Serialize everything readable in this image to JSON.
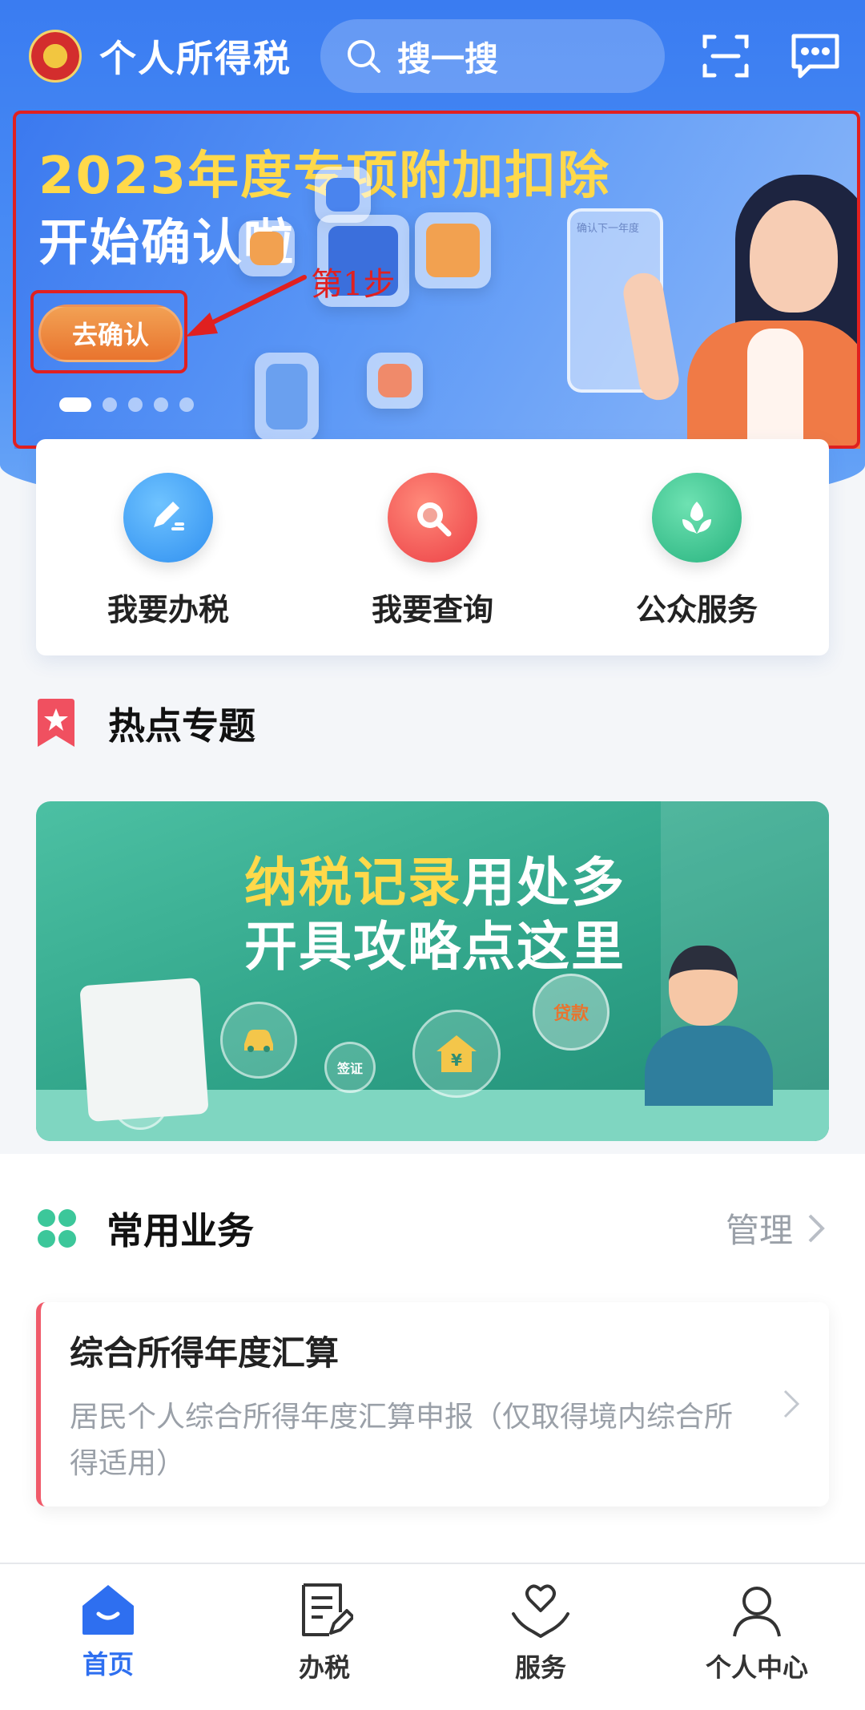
{
  "header": {
    "app_title": "个人所得税",
    "search_label": "搜一搜"
  },
  "banner": {
    "title_highlight_year": "2023年度",
    "title_highlight_rest": "专项附加扣除",
    "title_line2": "开始确认啦",
    "button_label": "去确认",
    "phone_text": "确认下一年度",
    "carousel": {
      "count": 5,
      "active_index": 0
    }
  },
  "annotation": {
    "step_label": "第1步",
    "color": "#e02020"
  },
  "quick_actions": [
    {
      "label": "我要办税",
      "icon": "edit-icon",
      "color": "#3aa3f5"
    },
    {
      "label": "我要查询",
      "icon": "search-icon",
      "color": "#f0504e"
    },
    {
      "label": "公众服务",
      "icon": "tulip-icon",
      "color": "#33c38f"
    }
  ],
  "hot_topics": {
    "section_title": "热点专题",
    "banner_line1_highlight": "纳税记录",
    "banner_line1_rest": "用处多",
    "banner_line2": "开具攻略点这里",
    "bubble_loan": "贷款",
    "bubble_cert": "签证"
  },
  "common_business": {
    "section_title": "常用业务",
    "manage_label": "管理",
    "items": [
      {
        "title": "综合所得年度汇算",
        "description": "居民个人综合所得年度汇算申报（仅取得境内综合所得适用）"
      }
    ]
  },
  "tabbar": {
    "active_index": 0,
    "tabs": [
      {
        "label": "首页",
        "icon": "home-icon"
      },
      {
        "label": "办税",
        "icon": "document-edit-icon"
      },
      {
        "label": "服务",
        "icon": "heart-hands-icon"
      },
      {
        "label": "个人中心",
        "icon": "person-icon"
      }
    ]
  },
  "colors": {
    "primary_blue": "#3a7cf1",
    "accent_yellow": "#ffd94a",
    "button_orange": "#e9742e",
    "hot_green": "#2fa388",
    "tab_active": "#2e6ff0"
  }
}
